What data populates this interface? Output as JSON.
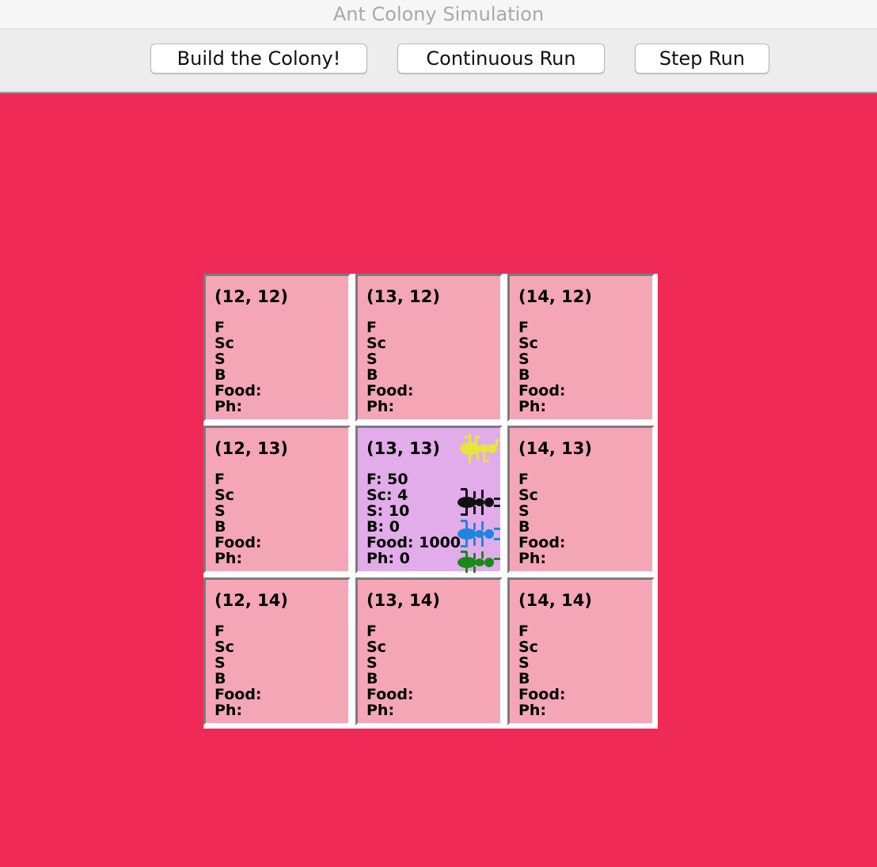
{
  "window": {
    "title": "Ant Colony Simulation"
  },
  "toolbar": {
    "build_label": "Build the Colony!",
    "continuous_label": "Continuous Run",
    "step_label": "Step Run"
  },
  "colors": {
    "background": "#ef2a57",
    "cell": "#f4a6b6",
    "colony_cell": "#e1ace9"
  },
  "grid": {
    "cells": [
      {
        "coord": "(12, 12)",
        "f": "F",
        "sc": "Sc",
        "s": "S",
        "b": "B",
        "food": "Food:",
        "ph": "Ph:"
      },
      {
        "coord": "(13, 12)",
        "f": "F",
        "sc": "Sc",
        "s": "S",
        "b": "B",
        "food": "Food:",
        "ph": "Ph:"
      },
      {
        "coord": "(14, 12)",
        "f": "F",
        "sc": "Sc",
        "s": "S",
        "b": "B",
        "food": "Food:",
        "ph": "Ph:"
      },
      {
        "coord": "(12, 13)",
        "f": "F",
        "sc": "Sc",
        "s": "S",
        "b": "B",
        "food": "Food:",
        "ph": "Ph:"
      },
      {
        "coord": "(13, 13)",
        "f": "F: 50",
        "sc": "Sc: 4",
        "s": "S: 10",
        "b": "B: 0",
        "food": "Food: 1000",
        "ph": "Ph: 0"
      },
      {
        "coord": "(14, 13)",
        "f": "F",
        "sc": "Sc",
        "s": "S",
        "b": "B",
        "food": "Food:",
        "ph": "Ph:"
      },
      {
        "coord": "(12, 14)",
        "f": "F",
        "sc": "Sc",
        "s": "S",
        "b": "B",
        "food": "Food:",
        "ph": "Ph:"
      },
      {
        "coord": "(13, 14)",
        "f": "F",
        "sc": "Sc",
        "s": "S",
        "b": "B",
        "food": "Food:",
        "ph": "Ph:"
      },
      {
        "coord": "(14, 14)",
        "f": "F",
        "sc": "Sc",
        "s": "S",
        "b": "B",
        "food": "Food:",
        "ph": "Ph:"
      }
    ],
    "colony_ants": [
      {
        "icon": "queen-ant-icon",
        "color": "#e6e63c"
      },
      {
        "icon": "bala-ant-icon",
        "color": "#111111"
      },
      {
        "icon": "scout-ant-icon",
        "color": "#1e86e0"
      },
      {
        "icon": "forager-ant-icon",
        "color": "#1a8a1a"
      }
    ]
  }
}
